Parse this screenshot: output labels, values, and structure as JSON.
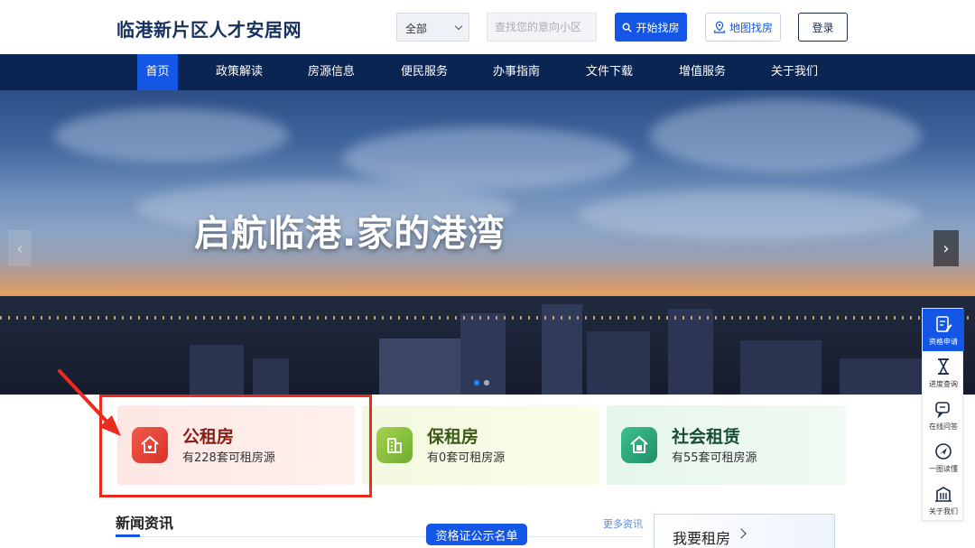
{
  "header": {
    "site_title": "临港新片区人才安居网",
    "select": {
      "value": "全部"
    },
    "search": {
      "placeholder": "查找您的意向小区"
    },
    "search_button": "开始找房",
    "map_button": "地图找房",
    "login_button": "登录"
  },
  "nav": {
    "items": [
      {
        "label": "首页",
        "active": true
      },
      {
        "label": "政策解读"
      },
      {
        "label": "房源信息"
      },
      {
        "label": "便民服务"
      },
      {
        "label": "办事指南"
      },
      {
        "label": "文件下载"
      },
      {
        "label": "增值服务"
      },
      {
        "label": "关于我们"
      }
    ]
  },
  "banner": {
    "slogan": "启航临港.家的港湾",
    "slide_count": 2,
    "active_slide": 1
  },
  "cards": [
    {
      "title": "公租房",
      "subtitle": "有228套可租房源",
      "icon": "house-heart-icon",
      "color": "#e8403a"
    },
    {
      "title": "保租房",
      "subtitle": "有0套可租房源",
      "icon": "building-icon",
      "color": "#8cc63f"
    },
    {
      "title": "社会租赁",
      "subtitle": "有55套可租房源",
      "icon": "house-bao-icon",
      "color": "#2ea87a"
    }
  ],
  "news": {
    "title": "新闻资讯",
    "more": "更多资讯",
    "cert_button": "资格证公示名单"
  },
  "rent": {
    "label": "我要租房"
  },
  "float_menu": [
    {
      "label": "资格申请",
      "icon": "edit-doc-icon",
      "active": true
    },
    {
      "label": "进度查询",
      "icon": "hourglass-icon"
    },
    {
      "label": "在线问答",
      "icon": "chat-icon"
    },
    {
      "label": "一图读懂",
      "icon": "compass-icon"
    },
    {
      "label": "关于我们",
      "icon": "building-icon"
    }
  ],
  "colors": {
    "primary": "#1456e6",
    "nav_bg": "#0b2553",
    "title_navy": "#16305f",
    "annotation_red": "#ec2b1f"
  }
}
